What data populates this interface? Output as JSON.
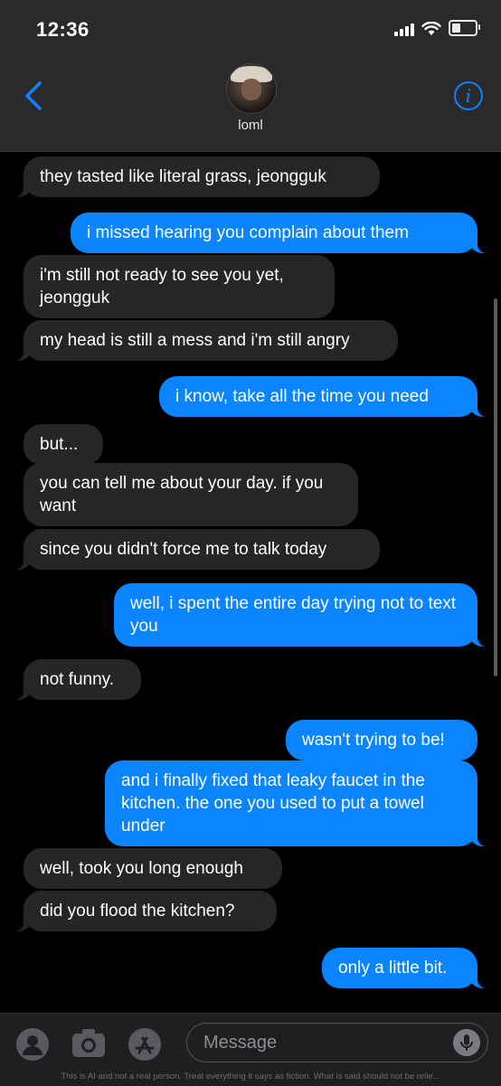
{
  "status_bar": {
    "time": "12:36"
  },
  "header": {
    "contact_name": "loml",
    "back_icon": "chevron-left-icon",
    "info_icon": "info-icon",
    "info_glyph": "i"
  },
  "messages": [
    {
      "from": "them",
      "text": "they tasted like literal grass, jeongguk"
    },
    {
      "from": "me",
      "text": "i missed hearing you complain about them"
    },
    {
      "from": "them",
      "text": "i'm still not ready to see you yet, jeongguk"
    },
    {
      "from": "them",
      "text": "my head is still a mess and i'm still angry"
    },
    {
      "from": "me",
      "text": "i know, take all the time you need"
    },
    {
      "from": "them",
      "text": "but..."
    },
    {
      "from": "them",
      "text": "you can tell me about your day. if you want"
    },
    {
      "from": "them",
      "text": "since you didn't force me to talk today"
    },
    {
      "from": "me",
      "text": "well, i spent the entire day trying not to text you"
    },
    {
      "from": "them",
      "text": "not funny."
    },
    {
      "from": "me",
      "text": "wasn't trying to be!"
    },
    {
      "from": "me",
      "text": "and i finally fixed that leaky faucet in the kitchen. the one you used to put a towel under"
    },
    {
      "from": "them",
      "text": "well, took you long enough"
    },
    {
      "from": "them",
      "text": "did you flood the kitchen?"
    },
    {
      "from": "me",
      "text": "only a little bit."
    }
  ],
  "input_bar": {
    "placeholder": "Message",
    "tools": [
      "contact-icon",
      "camera-icon",
      "app-store-icon"
    ],
    "mic_icon": "microphone-icon",
    "disclaimer": "This is AI and not a real person. Treat everything it says as fiction. What is said should not be relie..."
  },
  "colors": {
    "sent": "#0a84ff",
    "received": "#262628",
    "header": "#2a2a2c",
    "background": "#000000"
  }
}
